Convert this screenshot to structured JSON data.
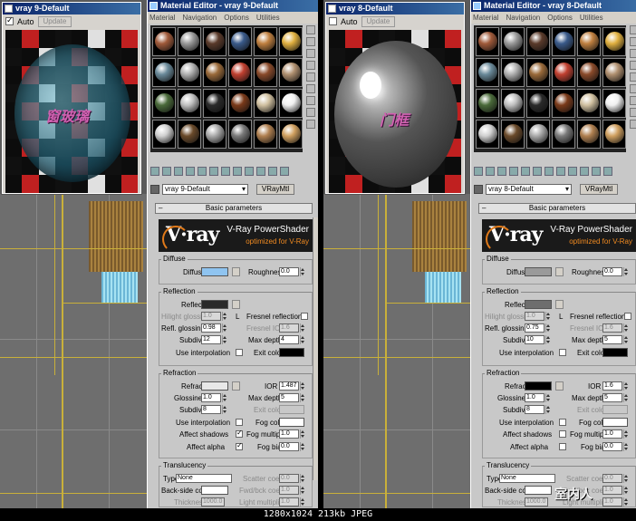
{
  "left": {
    "preview": {
      "title": "vray 9-Default",
      "auto_label": "Auto",
      "auto_checked": true,
      "update_label": "Update",
      "label_overlay": "窗玻璃"
    },
    "editor": {
      "title": "Material Editor - vray 9-Default",
      "menu": [
        "Material",
        "Navigation",
        "Options",
        "Utilities"
      ],
      "material_name": "vray 9-Default",
      "material_type": "VRayMtl",
      "rollout": "Basic parameters",
      "logo_main": "V-Ray PowerShader",
      "logo_sub": "optimized for V-Ray",
      "diffuse": {
        "group": "Diffuse",
        "label": "Diffuse",
        "color": "#8fc4f0",
        "roughness_label": "Roughness",
        "roughness": "0.0"
      },
      "reflection": {
        "group": "Reflection",
        "reflect_label": "Reflect",
        "reflect_color": "#2a2a2a",
        "hilight_label": "Hilight glossiness",
        "hilight": "1.0",
        "l_label": "L",
        "fresnel_label": "Fresnel reflections",
        "fresnel_ior_label": "Fresnel IOR",
        "fresnel_ior": "1.6",
        "refl_gloss_label": "Refl. glossiness",
        "refl_gloss": "0.98",
        "subdivs_label": "Subdivs",
        "subdivs": "12",
        "max_depth_label": "Max depth",
        "max_depth": "4",
        "use_interp_label": "Use interpolation",
        "exit_color_label": "Exit color",
        "exit_color": "#000000"
      },
      "refraction": {
        "group": "Refraction",
        "refract_label": "Refract",
        "refract_color": "#e8e8e8",
        "ior_label": "IOR",
        "ior": "1.487",
        "gloss_label": "Glossiness",
        "gloss": "1.0",
        "max_depth_label": "Max depth",
        "max_depth": "5",
        "subdivs_label": "Subdivs",
        "subdivs": "8",
        "exit_color_label": "Exit color",
        "use_interp_label": "Use interpolation",
        "fog_color_label": "Fog color",
        "fog_color": "#ffffff",
        "affect_shadows_label": "Affect shadows",
        "affect_shadows": true,
        "fog_mult_label": "Fog multiplier",
        "fog_mult": "1.0",
        "affect_alpha_label": "Affect alpha",
        "affect_alpha": true,
        "fog_bias_label": "Fog bias",
        "fog_bias": "0.0"
      },
      "translucency": {
        "group": "Translucency",
        "type_label": "Type",
        "type": "None",
        "scatter_label": "Scatter coeff",
        "scatter": "0.0",
        "backside_label": "Back-side color",
        "fwd_label": "Fwd/bck coeff",
        "fwd": "1.0",
        "thickness_label": "Thickness",
        "thickness": "1000.0",
        "light_mult_label": "Light multiplier",
        "light_mult": "1.0"
      }
    }
  },
  "right": {
    "preview": {
      "title": "vray 8-Default",
      "auto_label": "Auto",
      "auto_checked": false,
      "update_label": "Update",
      "label_overlay": "门框"
    },
    "editor": {
      "title": "Material Editor - vray 8-Default",
      "menu": [
        "Material",
        "Navigation",
        "Options",
        "Utilities"
      ],
      "material_name": "vray 8-Default",
      "material_type": "VRayMtl",
      "rollout": "Basic parameters",
      "logo_main": "V-Ray PowerShader",
      "logo_sub": "optimized for V-Ray",
      "diffuse": {
        "group": "Diffuse",
        "label": "Diffuse",
        "color": "#9a9a9a",
        "roughness_label": "Roughness",
        "roughness": "0.0"
      },
      "reflection": {
        "group": "Reflection",
        "reflect_label": "Reflect",
        "reflect_color": "#6e6e6e",
        "hilight_label": "Hilight glossiness",
        "hilight": "1.0",
        "l_label": "L",
        "fresnel_label": "Fresnel reflections",
        "fresnel_ior_label": "Fresnel IOR",
        "fresnel_ior": "1.6",
        "refl_gloss_label": "Refl. glossiness",
        "refl_gloss": "0.75",
        "subdivs_label": "Subdivs",
        "subdivs": "10",
        "max_depth_label": "Max depth",
        "max_depth": "5",
        "use_interp_label": "Use interpolation",
        "exit_color_label": "Exit color",
        "exit_color": "#000000"
      },
      "refraction": {
        "group": "Refraction",
        "refract_label": "Refract",
        "refract_color": "#000000",
        "ior_label": "IOR",
        "ior": "1.6",
        "gloss_label": "Glossiness",
        "gloss": "1.0",
        "max_depth_label": "Max depth",
        "max_depth": "5",
        "subdivs_label": "Subdivs",
        "subdivs": "8",
        "exit_color_label": "Exit color",
        "use_interp_label": "Use interpolation",
        "fog_color_label": "Fog color",
        "fog_color": "#ffffff",
        "affect_shadows_label": "Affect shadows",
        "affect_shadows": false,
        "fog_mult_label": "Fog multiplier",
        "fog_mult": "1.0",
        "affect_alpha_label": "Affect alpha",
        "affect_alpha": false,
        "fog_bias_label": "Fog bias",
        "fog_bias": "0.0"
      },
      "translucency": {
        "group": "Translucency",
        "type_label": "Type",
        "type": "None",
        "scatter_label": "Scatter coeff",
        "scatter": "0.0",
        "backside_label": "Back-side color",
        "fwd_label": "Fwd/bck coeff",
        "fwd": "1.0",
        "thickness_label": "Thickness",
        "thickness": "1000.0",
        "light_mult_label": "Light multiplier",
        "light_mult": "1.0"
      }
    }
  },
  "status": "1280x1024  213kb  JPEG",
  "watermark": "室内人"
}
